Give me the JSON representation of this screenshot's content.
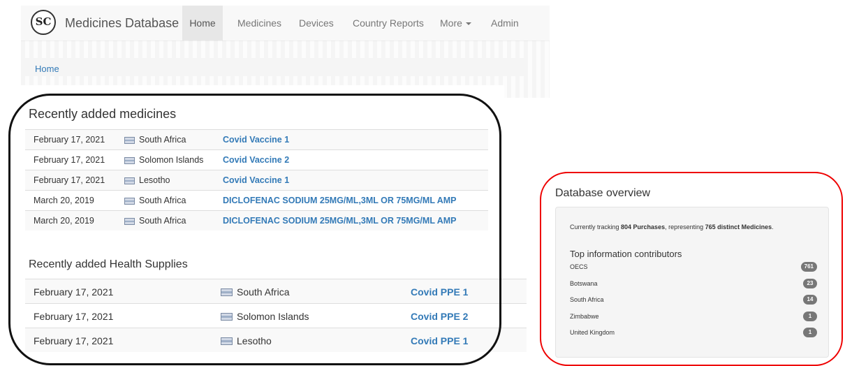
{
  "navbar": {
    "logo_text": "SC",
    "brand": "Medicines Database",
    "items": [
      "Home",
      "Medicines",
      "Devices",
      "Country Reports",
      "More",
      "Admin"
    ]
  },
  "breadcrumb": {
    "home": "Home"
  },
  "recent_medicines": {
    "title": "Recently added medicines",
    "rows": [
      {
        "date": "February 17, 2021",
        "country": "South Africa",
        "name": "Covid Vaccine 1"
      },
      {
        "date": "February 17, 2021",
        "country": "Solomon Islands",
        "name": "Covid Vaccine 2"
      },
      {
        "date": "February 17, 2021",
        "country": "Lesotho",
        "name": "Covid Vaccine 1"
      },
      {
        "date": "March 20, 2019",
        "country": "South Africa",
        "name": "DICLOFENAC SODIUM 25MG/ML,3ML OR 75MG/ML AMP"
      },
      {
        "date": "March 20, 2019",
        "country": "South Africa",
        "name": "DICLOFENAC SODIUM 25MG/ML,3ML OR 75MG/ML AMP"
      }
    ]
  },
  "recent_supplies": {
    "title": "Recently added Health Supplies",
    "rows": [
      {
        "date": "February 17, 2021",
        "country": "South Africa",
        "name": "Covid PPE 1"
      },
      {
        "date": "February 17, 2021",
        "country": "Solomon Islands",
        "name": "Covid PPE 2"
      },
      {
        "date": "February 17, 2021",
        "country": "Lesotho",
        "name": "Covid PPE 1"
      }
    ]
  },
  "overview": {
    "title": "Database overview",
    "tracking_prefix": "Currently tracking ",
    "purchases": "804 Purchases",
    "tracking_middle": ", representing ",
    "medicines": "765 distinct Medicines",
    "tracking_suffix": ".",
    "contributors_title": "Top information contributors",
    "contributors": [
      {
        "name": "OECS",
        "count": "761"
      },
      {
        "name": "Botswana",
        "count": "23"
      },
      {
        "name": "South Africa",
        "count": "14"
      },
      {
        "name": "Zimbabwe",
        "count": "1"
      },
      {
        "name": "United Kingdom",
        "count": "1"
      }
    ]
  }
}
